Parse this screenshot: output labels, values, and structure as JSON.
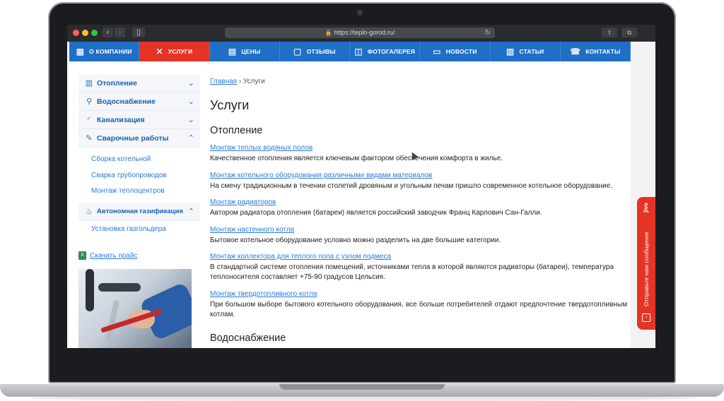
{
  "browser": {
    "url": "https://teplo-gorod.ru/",
    "back_icon": "chevron-left-icon",
    "forward_icon": "chevron-right-icon"
  },
  "topnav": [
    {
      "label": "О КОМПАНИИ",
      "icon": "building-icon",
      "glyph": "▦"
    },
    {
      "label": "УСЛУГИ",
      "icon": "tools-icon",
      "glyph": "✕"
    },
    {
      "label": "ЦЕНЫ",
      "icon": "price-icon",
      "glyph": "▤"
    },
    {
      "label": "ОТЗЫВЫ",
      "icon": "comment-icon",
      "glyph": "▢"
    },
    {
      "label": "ФОТОГАЛЕРЕЯ",
      "icon": "camera-icon",
      "glyph": "◫"
    },
    {
      "label": "НОВОСТИ",
      "icon": "news-icon",
      "glyph": "▭"
    },
    {
      "label": "СТАТЬИ",
      "icon": "document-icon",
      "glyph": "▥"
    },
    {
      "label": "КОНТАКТЫ",
      "icon": "phone-icon",
      "glyph": "☎"
    }
  ],
  "sidebar": {
    "items": [
      {
        "label": "Отопление",
        "icon": "radiator-icon"
      },
      {
        "label": "Водоснабжение",
        "icon": "faucet-icon"
      },
      {
        "label": "Канализация",
        "icon": "pipe-icon"
      },
      {
        "label": "Сварочные работы",
        "icon": "welding-icon"
      }
    ],
    "welding_sub": [
      "Сборка котельной",
      "Сварка трубопроводов",
      "Монтаж теплоцентров"
    ],
    "gas": {
      "label": "Автономная газификация",
      "icon": "flame-icon"
    },
    "gas_sub": [
      "Установка газгольдера"
    ],
    "price_link": "Скачать прайс"
  },
  "breadcrumb": {
    "home": "Главная",
    "sep": "›",
    "current": "Услуги"
  },
  "page_title": "Услуги",
  "section_title": "Отопление",
  "services": [
    {
      "title": "Монтаж теплых водяных полов",
      "desc": "Качественное отопления является ключевым фактором обеспечения комфорта в жилье."
    },
    {
      "title": "Монтаж котельного оборудования различными видами материалов",
      "desc": "На смену традиционным в течении столетий дровяным и угольным печам пришло современное котельное оборудование."
    },
    {
      "title": "Монтаж радиаторов",
      "desc": "Автором радиатора отопления (батареи) является российский заводчик Франц Карлович Сан-Галли."
    },
    {
      "title": "Монтаж настенного котла",
      "desc": "Бытовое котельное оборудование условно можно разделить на две большие категории."
    },
    {
      "title": "Монтаж коллектора для теплого пола с узлом подмеса",
      "desc": "В стандартной системе отопления помещений, источниками тепла в которой являются радиаторы (батареи), температура теплоносителя составляет +75-90 градусов Цельсия."
    },
    {
      "title": "Монтаж твердотопливного котла",
      "desc": "При большом выборе бытового котельного оборудования, все больше потребителей отдают предпочтение твердотопливным котлам."
    }
  ],
  "next_section": "Водоснабжение",
  "chat": {
    "label": "Отправьте нам сообщение",
    "brand": "jivo"
  },
  "colors": {
    "accent": "#1f6fc6",
    "active": "#e53326",
    "link": "#2a7ad6"
  }
}
